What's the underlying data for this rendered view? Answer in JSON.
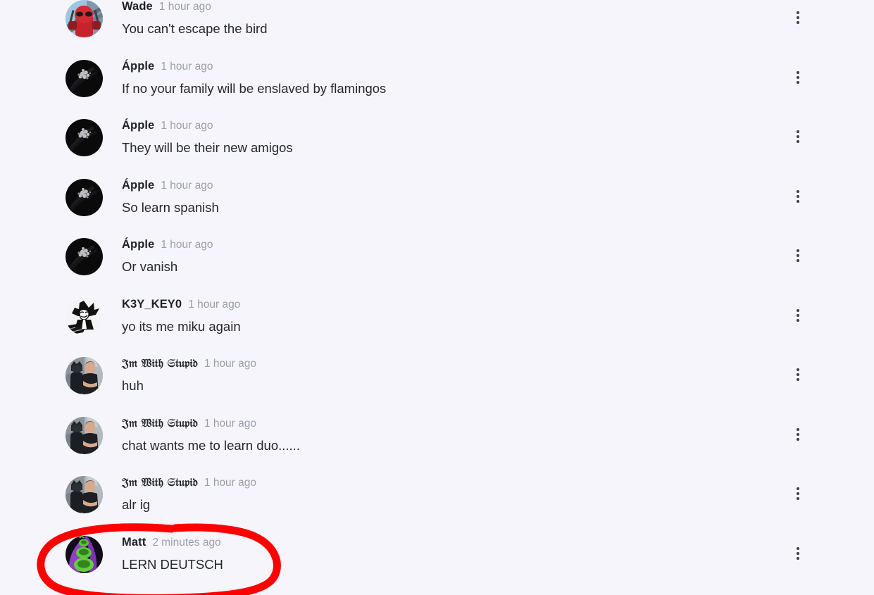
{
  "theme": {
    "background": "#f5f5fb",
    "author_color": "#1f2129",
    "timestamp_color": "#9ca0ab",
    "message_color": "#26282f",
    "kebab_color": "#3c3f4c",
    "annotation_color": "#ff0000"
  },
  "comments": [
    {
      "author": "Wade",
      "timestamp": "1 hour ago",
      "message": "You can't escape the bird",
      "avatar": "deadpool-avatar",
      "menu": "more-options-icon",
      "fraktur": false,
      "highlighted": false
    },
    {
      "author": "Ápple",
      "timestamp": "1 hour ago",
      "message": "If no your family will be enslaved by flamingos",
      "avatar": "dark-smudge-avatar",
      "menu": "more-options-icon",
      "fraktur": false,
      "highlighted": false
    },
    {
      "author": "Ápple",
      "timestamp": "1 hour ago",
      "message": "They will be their new amigos",
      "avatar": "dark-smudge-avatar",
      "menu": "more-options-icon",
      "fraktur": false,
      "highlighted": false
    },
    {
      "author": "Ápple",
      "timestamp": "1 hour ago",
      "message": "So learn spanish",
      "avatar": "dark-smudge-avatar",
      "menu": "more-options-icon",
      "fraktur": false,
      "highlighted": false
    },
    {
      "author": "Ápple",
      "timestamp": "1 hour ago",
      "message": "Or vanish",
      "avatar": "dark-smudge-avatar",
      "menu": "more-options-icon",
      "fraktur": false,
      "highlighted": false
    },
    {
      "author": "K3Y_KEY0",
      "timestamp": "1 hour ago",
      "message": "yo its me miku again",
      "avatar": "cartoon-sketch-avatar",
      "menu": "more-options-icon",
      "fraktur": false,
      "highlighted": false
    },
    {
      "author": "𝔍𝔪 𝔚𝔦𝔱𝔥 𝔖𝔱𝔲𝔭𝔦𝔡",
      "timestamp": "1 hour ago",
      "message": "huh",
      "avatar": "batman-photo-avatar",
      "menu": "more-options-icon",
      "fraktur": true,
      "highlighted": false
    },
    {
      "author": "𝔍𝔪 𝔚𝔦𝔱𝔥 𝔖𝔱𝔲𝔭𝔦𝔡",
      "timestamp": "1 hour ago",
      "message": "chat wants me to learn duo......",
      "avatar": "batman-photo-avatar",
      "menu": "more-options-icon",
      "fraktur": true,
      "highlighted": false
    },
    {
      "author": "𝔍𝔪 𝔚𝔦𝔱𝔥 𝔖𝔱𝔲𝔭𝔦𝔡",
      "timestamp": "1 hour ago",
      "message": "alr ig",
      "avatar": "batman-photo-avatar",
      "menu": "more-options-icon",
      "fraktur": true,
      "highlighted": false
    },
    {
      "author": "Matt",
      "timestamp": "2 minutes ago",
      "message": "LERN DEUTSCH",
      "avatar": "purple-green-creature-avatar",
      "menu": "more-options-icon",
      "fraktur": false,
      "highlighted": true
    }
  ],
  "annotation": {
    "name": "red-circle-highlight",
    "shape": "hand-drawn-ellipse",
    "color": "#ff0000",
    "targets_comment_index": 9
  }
}
